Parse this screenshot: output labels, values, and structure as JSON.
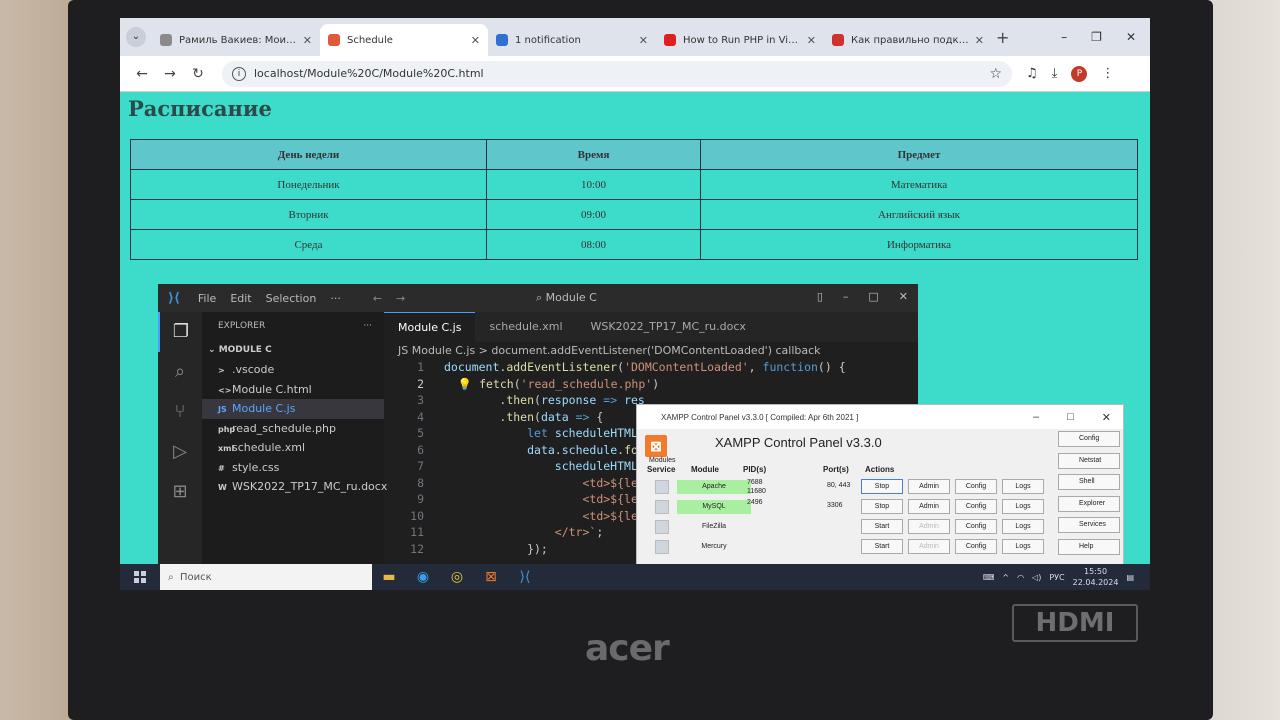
{
  "browser": {
    "tabs": [
      {
        "label": "Рамиль Вакиев: Мои трек",
        "color": "#8a8a8a",
        "active": false
      },
      {
        "label": "Schedule",
        "color": "#e05a3a",
        "active": true
      },
      {
        "label": "1 notification",
        "color": "#2f6fd6",
        "active": false
      },
      {
        "label": "How to Run PHP in Visual S",
        "color": "#e02020",
        "active": false
      },
      {
        "label": "Как правильно подключи",
        "color": "#d03030",
        "active": false
      }
    ],
    "url": "localhost/Module%20C/Module%20C.html"
  },
  "page": {
    "title": "Расписание",
    "headers": [
      "День недели",
      "Время",
      "Предмет"
    ],
    "rows": [
      [
        "Понедельник",
        "10:00",
        "Математика"
      ],
      [
        "Вторник",
        "09:00",
        "Английский язык"
      ],
      [
        "Среда",
        "08:00",
        "Информатика"
      ]
    ]
  },
  "vscode": {
    "menu": [
      "File",
      "Edit",
      "Selection",
      "···"
    ],
    "search": "Module C",
    "explorer_title": "EXPLORER",
    "root": "MODULE C",
    "files": [
      {
        "icon": ">",
        "name": ".vscode"
      },
      {
        "icon": "<>",
        "name": "Module C.html"
      },
      {
        "icon": "JS",
        "name": "Module C.js"
      },
      {
        "icon": "php",
        "name": "read_schedule.php"
      },
      {
        "icon": "xml",
        "name": "schedule.xml"
      },
      {
        "icon": "#",
        "name": "style.css"
      },
      {
        "icon": "W",
        "name": "WSK2022_TP17_MC_ru.docx"
      }
    ],
    "tabs": [
      "Module C.js",
      "schedule.xml",
      "WSK2022_TP17_MC_ru.docx"
    ],
    "breadcrumb": "JS Module C.js > document.addEventListener('DOMContentLoaded') callback"
  },
  "xampp": {
    "title": "XAMPP Control Panel v3.3.0   [ Compiled: Apr 6th 2021 ]",
    "heading": "XAMPP Control Panel v3.3.0",
    "modules_label": "Modules",
    "columns": [
      "Service",
      "Module",
      "PID(s)",
      "Port(s)",
      "Actions"
    ],
    "rows": [
      {
        "module": "Apache",
        "pid": "7688\n11680",
        "port": "80, 443",
        "action": "Stop",
        "running": true
      },
      {
        "module": "MySQL",
        "pid": "2496",
        "port": "3306",
        "action": "Stop",
        "running": true
      },
      {
        "module": "FileZilla",
        "pid": "",
        "port": "",
        "action": "Start",
        "running": false
      },
      {
        "module": "Mercury",
        "pid": "",
        "port": "",
        "action": "Start",
        "running": false
      }
    ],
    "btn_admin": "Admin",
    "btn_config": "Config",
    "btn_logs": "Logs",
    "right_buttons": [
      "Config",
      "Netstat",
      "Shell",
      "Explorer",
      "Services",
      "Help"
    ]
  },
  "taskbar": {
    "search": "Поиск",
    "lang": "РУС",
    "time": "15:50",
    "date": "22.04.2024"
  },
  "device": {
    "brand": "acer",
    "port_label": "HDMI"
  }
}
